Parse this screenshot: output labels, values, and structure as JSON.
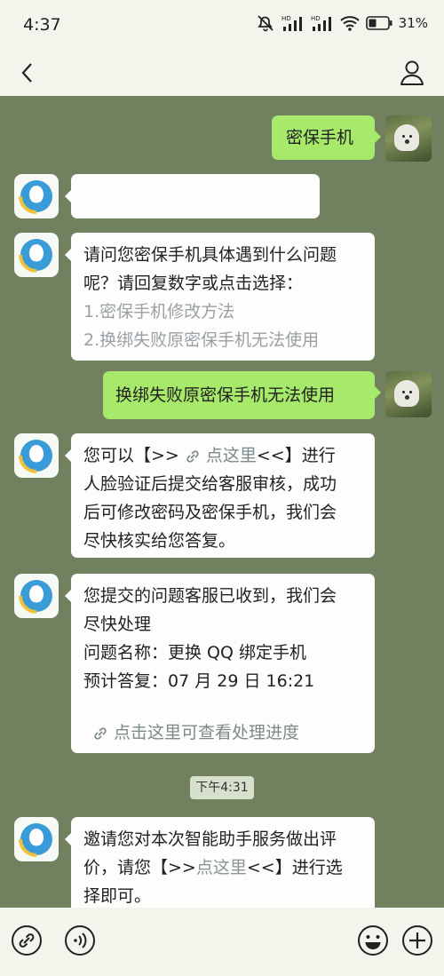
{
  "status_bar": {
    "time": "4:37",
    "battery": "31%",
    "icons": [
      "mute-icon",
      "signal-hd-icon",
      "signal-hd-icon",
      "wifi-icon",
      "battery-icon"
    ]
  },
  "nav": {
    "back_icon": "back-arrow-icon",
    "profile_icon": "user-icon"
  },
  "messages": {
    "m1": {
      "from": "me",
      "text": "密保手机"
    },
    "m2": {
      "from": "bot",
      "text": ""
    },
    "m3": {
      "from": "bot",
      "line1": "请问您密保手机具体遇到什么问题",
      "line2": "呢？请回复数字或点击选择：",
      "option1": "1.密保手机修改方法",
      "option2": "2.换绑失败原密保手机无法使用"
    },
    "m4": {
      "from": "me",
      "text": "换绑失败原密保手机无法使用"
    },
    "m5": {
      "from": "bot",
      "prefix": "您可以【>>",
      "link": "点这里",
      "suffix": "<<】进行",
      "line2": "人脸验证后提交给客服审核，成功",
      "line3": "后可修改密码及密保手机，我们会",
      "line4": "尽快核实给您答复。"
    },
    "m6": {
      "from": "bot",
      "line1": "您提交的问题客服已收到，我们会",
      "line2": "尽快处理",
      "line3": "问题名称：更换 QQ 绑定手机",
      "line4": "预计答复：07 月 29 日 16:21",
      "progress_link": "点击这里可查看处理进度"
    },
    "timestamp": "下午4:31",
    "m7": {
      "from": "bot",
      "line1": "邀请您对本次智能助手服务做出评",
      "line2_a": "价，请您【>>",
      "link": "点这里",
      "line2_b": "<<】进行选",
      "line3": "择即可。"
    }
  },
  "input_bar": {
    "icons": [
      "link-icon",
      "voice-icon",
      "emoji-icon",
      "plus-icon"
    ]
  },
  "colors": {
    "chat_bg": "#71805e",
    "my_bubble": "#a7e96a",
    "bot_bubble": "#fdfdfc",
    "bar_bg": "#f1f5ec"
  }
}
